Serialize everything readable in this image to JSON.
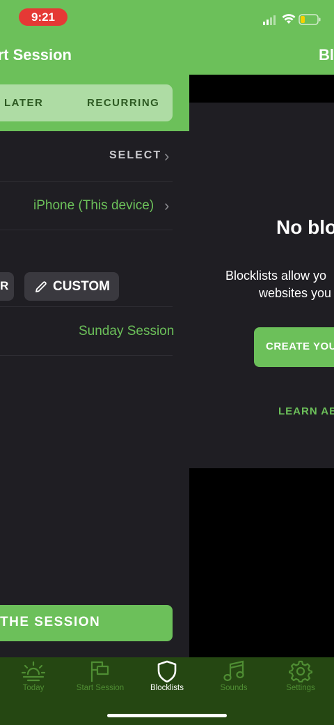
{
  "status_bar": {
    "time": "9:21"
  },
  "left_panel": {
    "title": "rt Session",
    "segments": [
      "LATER",
      "RECURRING"
    ],
    "select_label": "SELECT",
    "device_label": "iPhone (This device)",
    "chip_partial": "R",
    "custom_label": "CUSTOM",
    "session_name": "Sunday Session",
    "start_button": "THE SESSION"
  },
  "right_panel": {
    "title": "Bl",
    "empty_title": "No blo",
    "desc_line1": "Blocklists allow yo",
    "desc_line2": "websites you",
    "create_button": "CREATE YOU",
    "learn_link": "LEARN AB"
  },
  "tab_bar": {
    "tabs": [
      {
        "label": "Today",
        "icon": "sun-horizon-icon",
        "active": false
      },
      {
        "label": "Start Session",
        "icon": "flag-icon",
        "active": false
      },
      {
        "label": "Blocklists",
        "icon": "shield-icon",
        "active": true
      },
      {
        "label": "Sounds",
        "icon": "music-note-icon",
        "active": false
      },
      {
        "label": "Settings",
        "icon": "gear-icon",
        "active": false
      }
    ]
  },
  "colors": {
    "accent": "#6cc05a",
    "panel_bg": "#1f1e23",
    "tab_bar_bg": "#254712",
    "time_pill": "#e53935"
  }
}
